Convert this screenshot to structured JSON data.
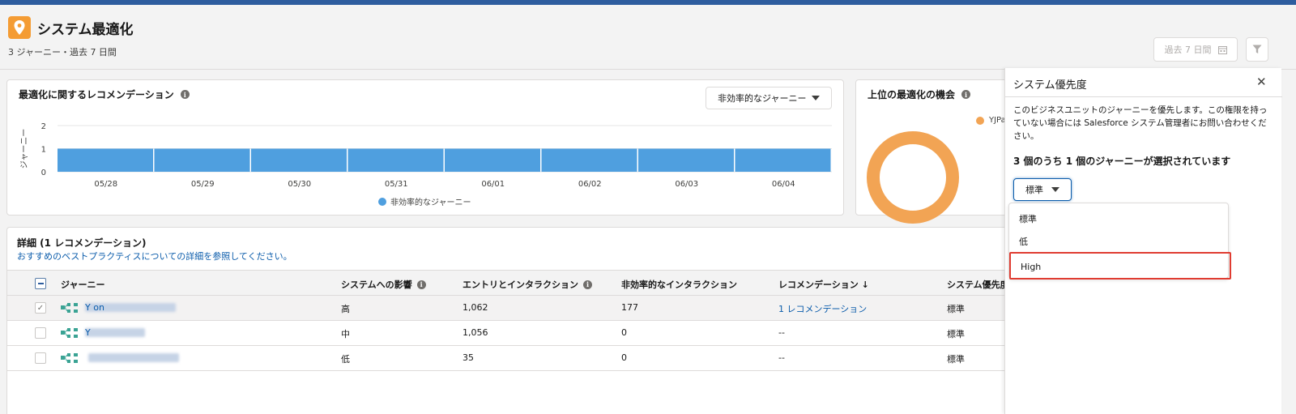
{
  "header": {
    "title": "システム最適化",
    "subtitle": "3 ジャーニー・過去 7 日間",
    "date_range_label": "過去 7 日間",
    "icon": "location-pin-icon",
    "accent_color": "#f49c34"
  },
  "recommendations_card": {
    "title": "最適化に関するレコメンデーション",
    "select_label": "非効率的なジャーニー"
  },
  "opportunities_card": {
    "title": "上位の最適化の機会",
    "legend_label": "YJPa"
  },
  "chart_data": {
    "type": "bar",
    "categories": [
      "05/28",
      "05/29",
      "05/30",
      "05/31",
      "06/01",
      "06/02",
      "06/03",
      "06/04"
    ],
    "series": [
      {
        "name": "非効率的なジャーニー",
        "values": [
          1,
          1,
          1,
          1,
          1,
          1,
          1,
          1
        ],
        "color": "#4f9fdf"
      }
    ],
    "ylabel": "ジャーニー",
    "yticks": [
      "0",
      "1",
      "2"
    ],
    "ylim": [
      0,
      2
    ],
    "grid": true,
    "legend": "bottom"
  },
  "details": {
    "title": "詳細 (1 レコメンデーション)",
    "link": "おすすめのベストプラクティスについての詳細を参照してください。",
    "columns": [
      "ジャーニー",
      "システムへの影響",
      "エントリとインタラクション",
      "非効率的なインタラクション",
      "レコメンデーション ↓",
      "システム優先度"
    ],
    "rows": [
      {
        "name": "Y on",
        "impact": "高",
        "entries": "1,062",
        "inefficient": "177",
        "recommendation": "1 レコメンデーション",
        "priority": "標準",
        "selected": true
      },
      {
        "name": "Y",
        "impact": "中",
        "entries": "1,056",
        "inefficient": "0",
        "recommendation": "--",
        "priority": "標準",
        "selected": false
      },
      {
        "name": "",
        "impact": "低",
        "entries": "35",
        "inefficient": "0",
        "recommendation": "--",
        "priority": "標準",
        "selected": false
      }
    ]
  },
  "panel": {
    "title": "システム優先度",
    "description": "このビジネスユニットのジャーニーを優先します。この権限を持っていない場合には Salesforce システム管理者にお問い合わせください。",
    "selection_count": "3 個のうち 1 個のジャーニーが選択されています",
    "priority_button": "標準",
    "options": [
      "標準",
      "低",
      "High"
    ],
    "highlight_color": "#e03c31"
  }
}
